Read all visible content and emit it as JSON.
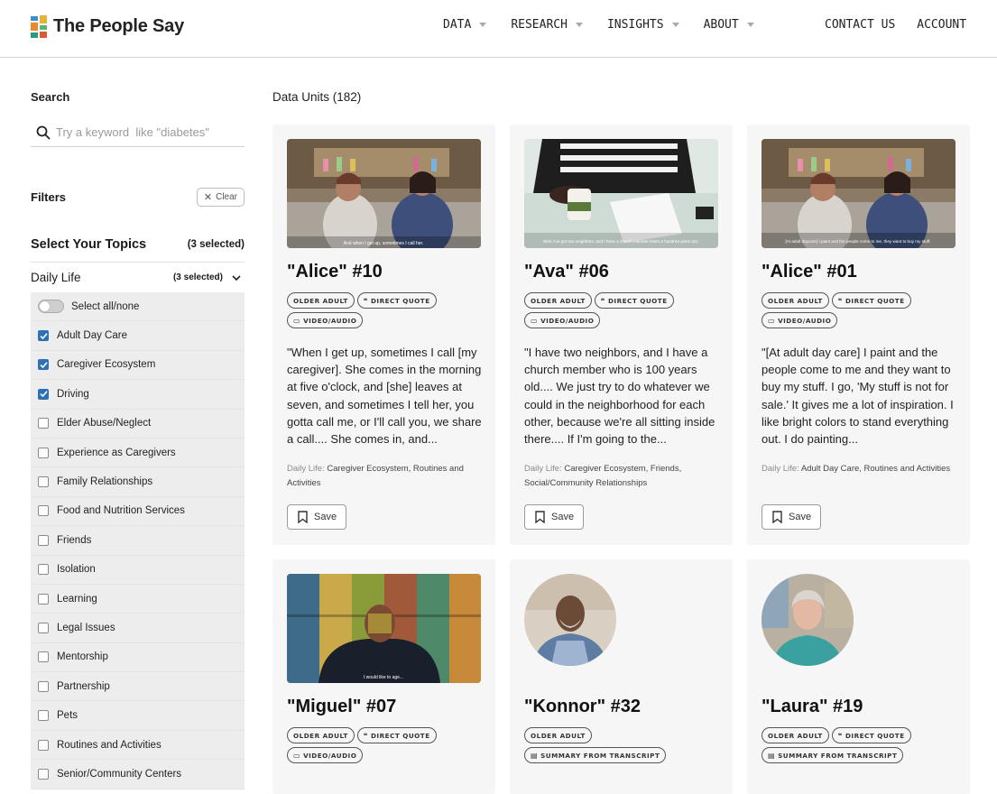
{
  "brand": {
    "name": "The People Say"
  },
  "nav": {
    "items": [
      {
        "label": "DATA"
      },
      {
        "label": "RESEARCH"
      },
      {
        "label": "INSIGHTS"
      },
      {
        "label": "ABOUT"
      }
    ],
    "contact": "CONTACT US",
    "account": "ACCOUNT"
  },
  "sidebar": {
    "search_label": "Search",
    "search_placeholder": "Try a keyword  like \"diabetes\"",
    "filters_label": "Filters",
    "clear_label": "Clear",
    "topics_title": "Select Your Topics",
    "topics_count": "(3 selected)",
    "group": {
      "label": "Daily Life",
      "count": "(3 selected)"
    },
    "select_all_label": "Select all/none",
    "topics": [
      {
        "label": "Adult Day Care",
        "checked": true
      },
      {
        "label": "Caregiver Ecosystem",
        "checked": true
      },
      {
        "label": "Driving",
        "checked": true
      },
      {
        "label": "Elder Abuse/Neglect",
        "checked": false
      },
      {
        "label": "Experience as Caregivers",
        "checked": false
      },
      {
        "label": "Family Relationships",
        "checked": false
      },
      {
        "label": "Food and Nutrition Services",
        "checked": false
      },
      {
        "label": "Friends",
        "checked": false
      },
      {
        "label": "Isolation",
        "checked": false
      },
      {
        "label": "Learning",
        "checked": false
      },
      {
        "label": "Legal Issues",
        "checked": false
      },
      {
        "label": "Mentorship",
        "checked": false
      },
      {
        "label": "Partnership",
        "checked": false
      },
      {
        "label": "Pets",
        "checked": false
      },
      {
        "label": "Routines and Activities",
        "checked": false
      },
      {
        "label": "Senior/Community Centers",
        "checked": false
      }
    ]
  },
  "main": {
    "units_title": "Data Units (182)",
    "cards": [
      {
        "title": "\"Alice\" #10",
        "tags": [
          "OLDER ADULT",
          "DIRECT QUOTE",
          "VIDEO/AUDIO"
        ],
        "quote": "\"When I get up, sometimes I call [my caregiver]. She comes in the morning at five o'clock, and [she] leaves at seven, and sometimes I tell her, you gotta call me, or I'll call you, we share a call.... She comes in, and...",
        "meta_key": "Daily Life:",
        "meta_val": "Caregiver Ecosystem, Routines and Activities",
        "save": "Save",
        "caption": "And when I get up, sometimes I call her."
      },
      {
        "title": "\"Ava\" #06",
        "tags": [
          "OLDER ADULT",
          "DIRECT QUOTE",
          "VIDEO/AUDIO"
        ],
        "quote": "\"I have two neighbors, and I have a church member who is 100 years old.... We just try to do whatever we could in the neighborhood for each other, because we're all sitting inside there.... If I'm going to the...",
        "meta_key": "Daily Life:",
        "meta_val": "Caregiver Ecosystem, Friends, Social/Community Relationships",
        "save": "Save",
        "caption": "Well, I've got two neighbors, and I have a church member that's a hundred years old."
      },
      {
        "title": "\"Alice\" #01",
        "tags": [
          "OLDER ADULT",
          "DIRECT QUOTE",
          "VIDEO/AUDIO"
        ],
        "quote": "\"[At adult day care] I paint and the people come to me and they want to buy my stuff. I go, 'My stuff is not for sale.' It gives me a lot of inspiration. I like bright colors to stand everything out. I do painting...",
        "meta_key": "Daily Life:",
        "meta_val": "Adult Day Care, Routines and Activities",
        "save": "Save",
        "caption": "[At adult daycare] I paint and the people come to me, they want to buy my stuff."
      },
      {
        "title": "\"Miguel\" #07",
        "tags": [
          "OLDER ADULT",
          "DIRECT QUOTE",
          "VIDEO/AUDIO"
        ],
        "caption": "I would like to age..."
      },
      {
        "title": "\"Konnor\" #32",
        "tags": [
          "OLDER ADULT",
          "SUMMARY FROM TRANSCRIPT"
        ]
      },
      {
        "title": "\"Laura\" #19",
        "tags": [
          "OLDER ADULT",
          "DIRECT QUOTE",
          "SUMMARY FROM TRANSCRIPT"
        ]
      }
    ]
  },
  "colors": {
    "accent": "#2f6fb3",
    "card_bg": "#f6f6f6",
    "filter_bg": "#ededed"
  },
  "icons": [
    "logo-mark-icon",
    "chevron-down-icon",
    "search-icon",
    "close-icon",
    "checkmark-icon",
    "quote-icon",
    "video-icon",
    "document-icon",
    "bookmark-icon"
  ]
}
